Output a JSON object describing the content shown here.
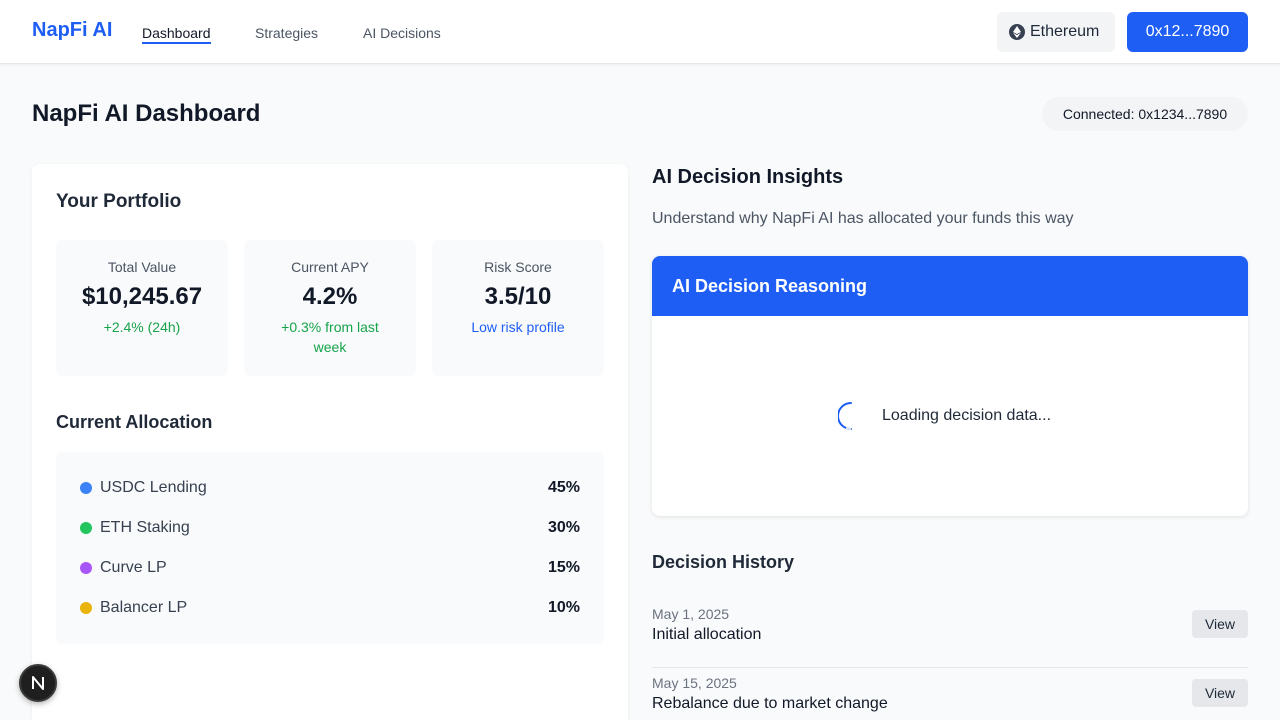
{
  "app": {
    "brand": "NapFi AI"
  },
  "nav": {
    "items": [
      {
        "label": "Dashboard",
        "active": true
      },
      {
        "label": "Strategies"
      },
      {
        "label": "AI Decisions"
      }
    ]
  },
  "header": {
    "network_label": "Ethereum",
    "wallet_label": "0x12...7890",
    "network_icon": "ethereum-icon"
  },
  "page": {
    "title": "NapFi AI Dashboard",
    "connected": "Connected: 0x1234...7890"
  },
  "portfolio": {
    "title": "Your Portfolio",
    "stats": [
      {
        "label": "Total Value",
        "value": "$10,245.67",
        "sub": "+2.4% (24h)",
        "sub_color": "#16a34a"
      },
      {
        "label": "Current APY",
        "value": "4.2%",
        "sub": "+0.3% from last week",
        "sub_color": "#16a34a"
      },
      {
        "label": "Risk Score",
        "value": "3.5/10",
        "sub": "Low risk profile",
        "sub_color": "#1e5ef5"
      }
    ],
    "allocation_title": "Current Allocation",
    "allocation": [
      {
        "name": "USDC Lending",
        "pct": "45%",
        "color": "#3b82f6"
      },
      {
        "name": "ETH Staking",
        "pct": "30%",
        "color": "#22c55e"
      },
      {
        "name": "Curve LP",
        "pct": "15%",
        "color": "#a855f7"
      },
      {
        "name": "Balancer LP",
        "pct": "10%",
        "color": "#eab308"
      }
    ]
  },
  "insights": {
    "title": "AI Decision Insights",
    "subtitle": "Understand why NapFi AI has allocated your funds this way",
    "reasoning_title": "AI Decision Reasoning",
    "loading_text": "Loading decision data..."
  },
  "history": {
    "title": "Decision History",
    "items": [
      {
        "date": "May 1, 2025",
        "desc": "Initial allocation",
        "button": "View"
      },
      {
        "date": "May 15, 2025",
        "desc": "Rebalance due to market change",
        "button": "View"
      }
    ]
  },
  "fab": {
    "letter": "N"
  }
}
